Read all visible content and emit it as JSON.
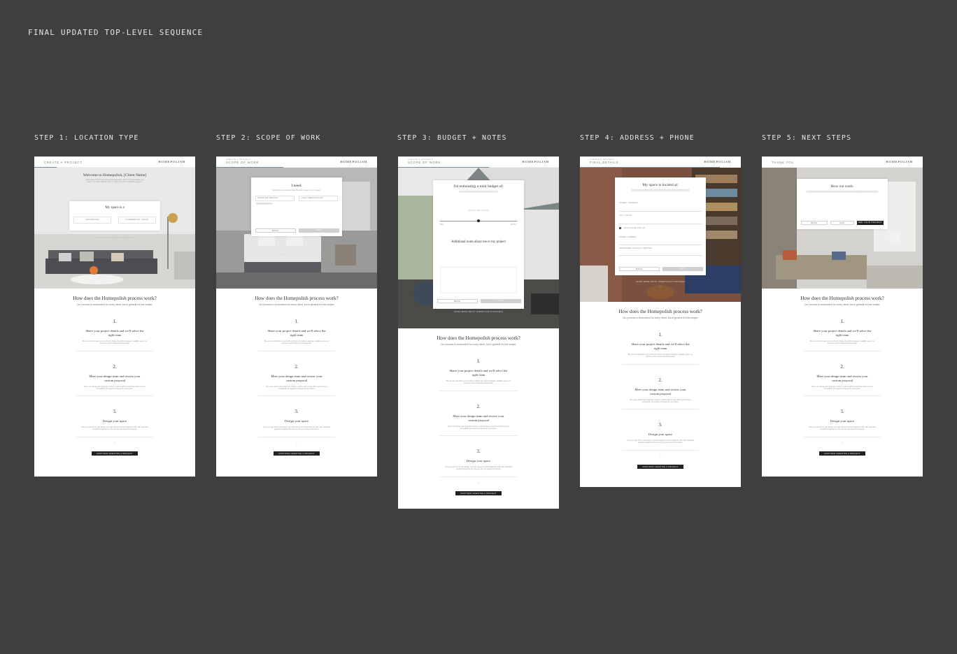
{
  "board_title": "FINAL UPDATED TOP-LEVEL SEQUENCE",
  "steps": [
    {
      "label": "STEP 1: LOCATION TYPE",
      "header": {
        "sub": "",
        "crumb": "CREATE A PROJECT",
        "brand": "HOMEPOLISH"
      },
      "card": {
        "title": "Welcome to Homepolish, [Client Name]",
        "intro": "We'll walk you through a few quick questions. The more information you share, the better we'll be able to match you with the perfect designer.",
        "question": "My space is a",
        "options": [
          "RESIDENCE",
          "COMMERCIAL SPACE"
        ]
      },
      "hero_link": "LEARN MORE ABOUT OUR PROCESS"
    },
    {
      "label": "STEP 2: SCOPE OF WORK",
      "header": {
        "sub": "CREATE A PROJECT",
        "crumb": "SCOPE OF WORK",
        "brand": "HOMEPOLISH"
      },
      "card": {
        "title": "I need:",
        "intro": "Select the one that best describes the scope of your project.",
        "options": [
          "INTERIOR DESIGN",
          "LIGHT RENOVATION"
        ],
        "back": "BACK",
        "next": "NEXT"
      },
      "hero_link": "LEARN MORE ABOUT HOMEPOLISH'S PROCESS"
    },
    {
      "label": "STEP 3: BUDGET + NOTES",
      "header": {
        "sub": "CREATE A PROJECT",
        "crumb": "SCOPE OF WORK",
        "brand": "HOMEPOLISH"
      },
      "card": {
        "title": "I'm estimating a total budget of:",
        "slider_hint": "Adjust the slider to budget",
        "slider_min": "$1K",
        "slider_max": "$75K+",
        "notes_title": "Additional notes about me or my project",
        "back": "BACK",
        "next": "NEXT"
      },
      "hero_link": "LEARN MORE ABOUT HOMEPOLISH'S PROCESS"
    },
    {
      "label": "STEP 4: ADDRESS + PHONE",
      "header": {
        "sub": "CREATE A PROJECT",
        "crumb": "FINAL DETAILS",
        "brand": "HOMEPOLISH"
      },
      "card": {
        "title": "My space is located at:",
        "field1": "STREET ADDRESS",
        "field2": "CITY, STATE",
        "check": "I'M OUTSIDE THE US",
        "field3": "PHONE NUMBER",
        "select": "PREFERRED CONTACT METHOD",
        "back": "BACK",
        "next": "NEXT"
      },
      "hero_link": "LEARN MORE ABOUT HOMEPOLISH'S PROCESS"
    },
    {
      "label": "STEP 5: NEXT STEPS",
      "header": {
        "sub": "",
        "crumb": "THANK YOU",
        "brand": "HOMEPOLISH"
      },
      "card": {
        "title": "How we work:",
        "btn1": "BACK",
        "btn2": "FAQ",
        "btn3": "SEE YOUR PROJECT"
      },
      "hero_link": "LEARN MORE ABOUT HOMEPOLISH'S PROCESS"
    }
  ],
  "process": {
    "title": "How does the Homepolish process work?",
    "intro": "Our process is customized for every client, but in general it's this simple:",
    "items": [
      {
        "num": "1.",
        "title": "Share your project details and we'll select the right team",
        "desc": "We use the information you provide to choose the perfect designer, available, given our extensive pool of talented professionals."
      },
      {
        "num": "2.",
        "title": "Meet your design team and review your custom proposal",
        "desc": "Once your design team has been chosen, you'll be able to meet them and receive a thoughtfully put together proposal for your space."
      },
      {
        "num": "3.",
        "title": "Design your space",
        "desc": "Once you sign off on your design, our team will get to work bringing it to life, with dedicated support throughout the process until your space is complete."
      }
    ],
    "cta": "CONTINUE CREATING A PROJECT"
  }
}
